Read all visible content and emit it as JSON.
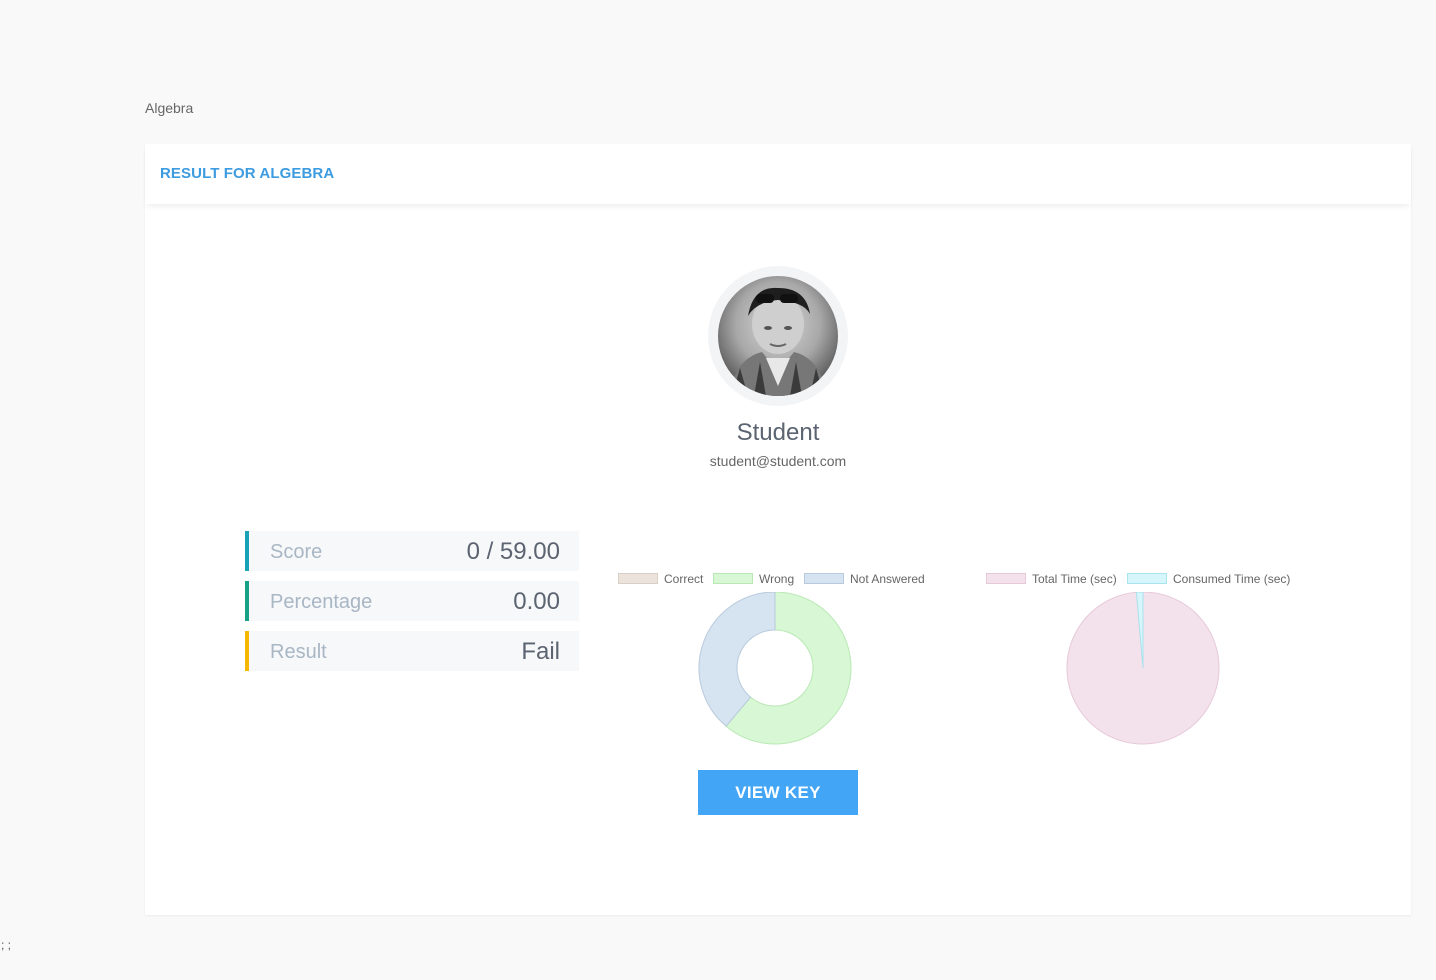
{
  "breadcrumb": "Algebra",
  "card": {
    "title": "RESULT FOR ALGEBRA"
  },
  "user": {
    "name": "Student",
    "email": "student@student.com"
  },
  "stats": [
    {
      "label": "Score",
      "value": "0 / 59.00",
      "color": "#17a2b8"
    },
    {
      "label": "Percentage",
      "value": "0.00",
      "color": "#16a085"
    },
    {
      "label": "Result",
      "value": "Fail",
      "color": "#f5b700"
    }
  ],
  "chart_data": [
    {
      "type": "pie",
      "variant": "doughnut",
      "categories": [
        "Correct",
        "Wrong",
        "Not Answered"
      ],
      "values": [
        0,
        22,
        14
      ],
      "colors": [
        "#ece4dc",
        "#d8f7d5",
        "#d6e3f0"
      ],
      "borders": [
        "#d8cfc5",
        "#b9e8b4",
        "#b8cadd"
      ],
      "legend": "top"
    },
    {
      "type": "pie",
      "categories": [
        "Total Time (sec)",
        "Consumed Time (sec)"
      ],
      "values": [
        1800,
        25
      ],
      "colors": [
        "#f3e2ec",
        "#d6f6fb"
      ],
      "borders": [
        "#e6c9d8",
        "#a9e3ee"
      ],
      "legend": "top"
    }
  ],
  "actions": {
    "view_key": "VIEW KEY"
  },
  "footer": {
    "text": "; ;"
  }
}
